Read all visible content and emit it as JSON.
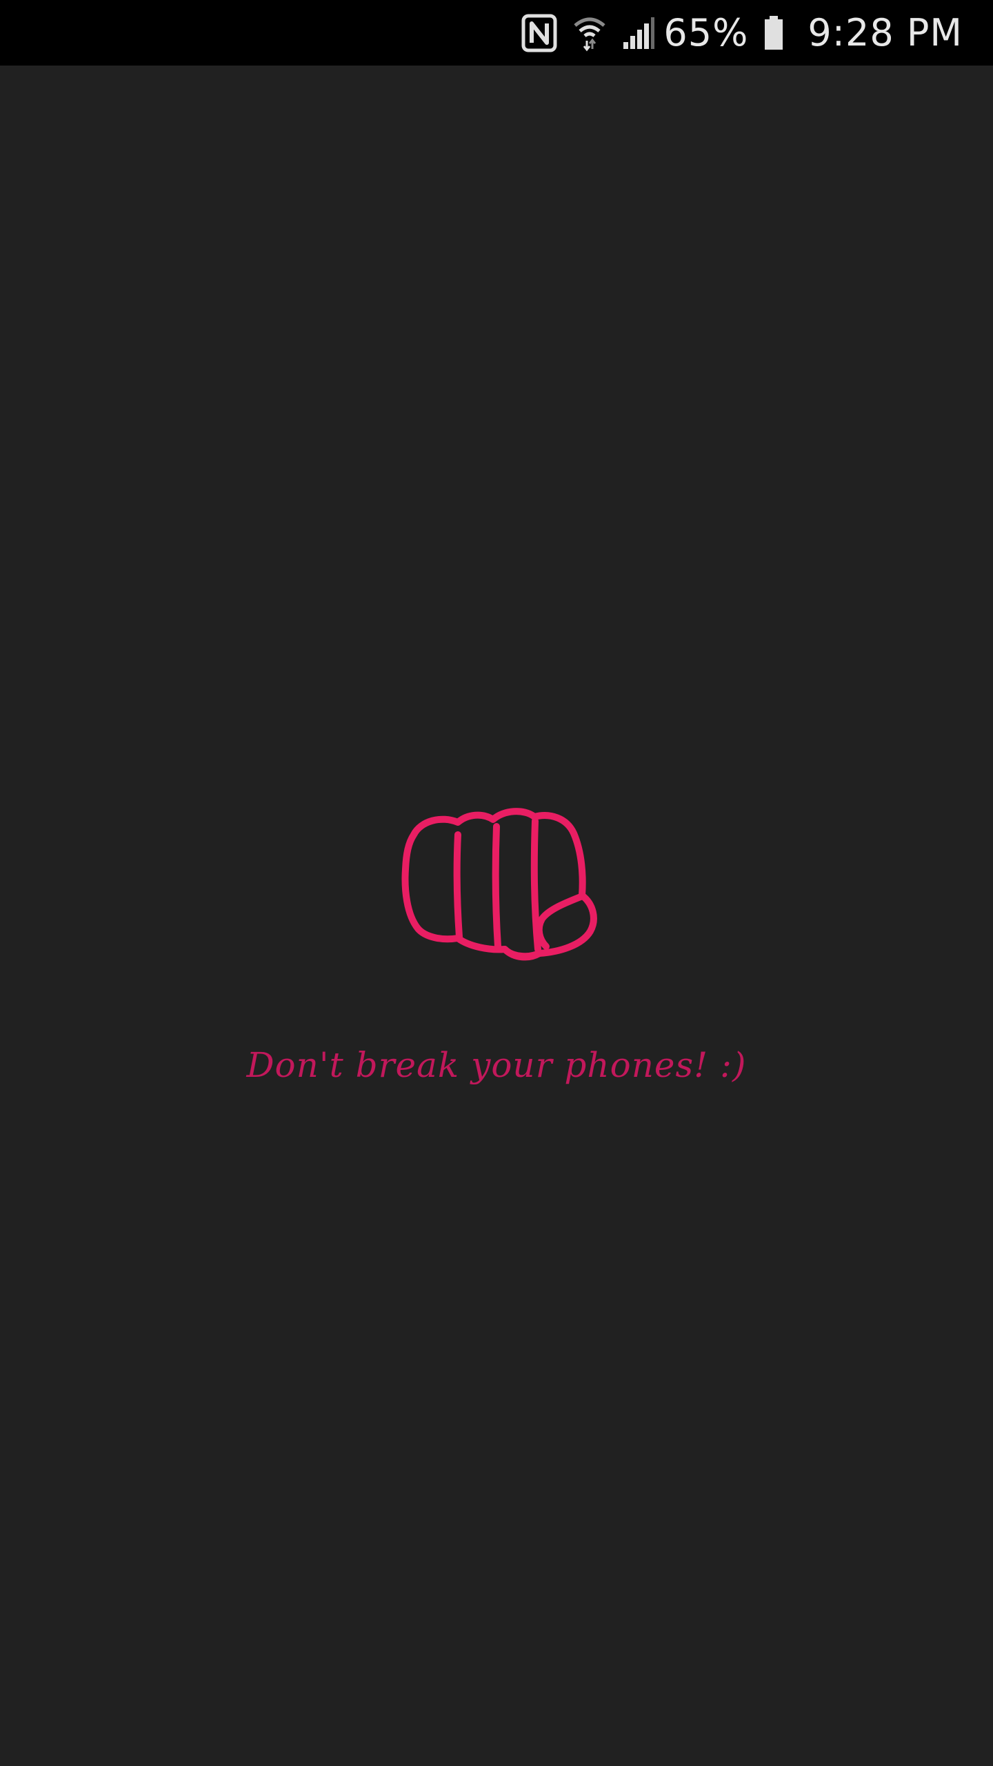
{
  "status_bar": {
    "battery_percent": "65%",
    "time": "9:28 PM",
    "icons": [
      "nfc-icon",
      "wifi-icon",
      "cell-signal-icon",
      "battery-icon"
    ]
  },
  "main": {
    "illustration_icon": "fist-icon",
    "message": "Don't break your phones! :)"
  },
  "colors": {
    "background": "#212121",
    "status_bar": "#000000",
    "accent": "#e91e63",
    "message_text": "#c2185b"
  }
}
